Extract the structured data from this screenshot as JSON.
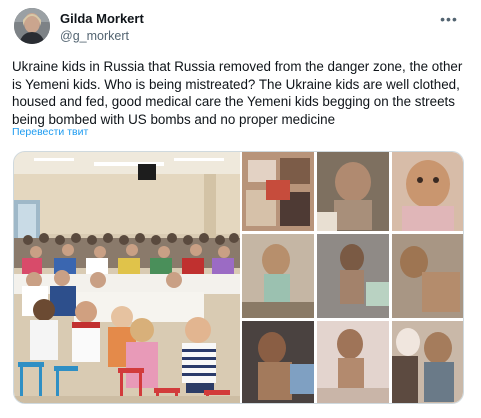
{
  "author": {
    "name": "Gilda Morkert",
    "handle": "@g_morkert"
  },
  "icons": {
    "more": "more-horizontal-icon",
    "avatar": "profile-avatar"
  },
  "tweet": {
    "text": "Ukraine kids in Russia that Russia removed from the danger zone, the other is Yemeni kids. Who is being mistreated? The Ukraine kids are well clothed, housed and fed, good medical care the Yemeni kids begging on the streets being bombed with US bombs and no proper medicine",
    "translate_label": "Перевести твит"
  },
  "media": {
    "left_photo": "children-dining-hall-photo",
    "right_photo": "yemeni-children-collage-photo"
  },
  "colors": {
    "link": "#1d9bf0",
    "text": "#0f1419",
    "muted": "#536471",
    "border": "#cfd9de"
  }
}
